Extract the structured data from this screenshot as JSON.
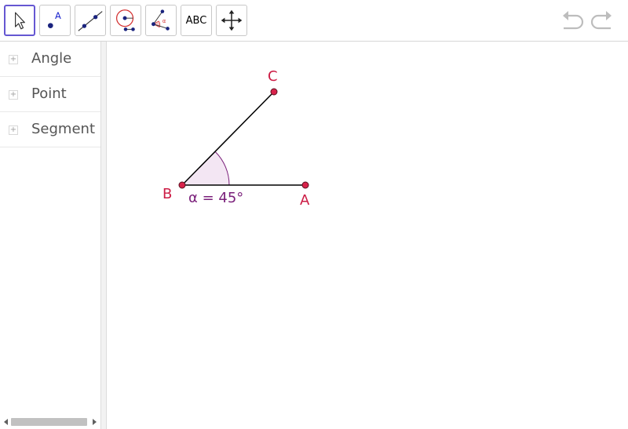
{
  "toolbar": {
    "tools": [
      {
        "name": "move",
        "icon": "cursor-arrow-icon",
        "selected": true
      },
      {
        "name": "point",
        "icon": "point-icon",
        "label": "A"
      },
      {
        "name": "line",
        "icon": "line-through-two-points-icon"
      },
      {
        "name": "circle",
        "icon": "circle-center-point-icon"
      },
      {
        "name": "angle",
        "icon": "angle-icon",
        "label": "α"
      },
      {
        "name": "text",
        "icon": "text-icon",
        "label": "ABC"
      },
      {
        "name": "move-graphics-view",
        "icon": "move-graphics-view-icon"
      }
    ],
    "undo_icon": "undo-icon",
    "redo_icon": "redo-icon"
  },
  "algebra": {
    "items": [
      {
        "label": "Angle"
      },
      {
        "label": "Point"
      },
      {
        "label": "Segment"
      }
    ],
    "expand_glyph": "+"
  },
  "graphics": {
    "points": [
      {
        "label": "A"
      },
      {
        "label": "B"
      },
      {
        "label": "C"
      }
    ],
    "angle_label": "α = 45°",
    "colors": {
      "point_fill": "#d8224a",
      "point_label": "#cc1b44",
      "angle_fill": "#f3e6f3",
      "angle_stroke": "#7a1f7a",
      "angle_label": "#7a1f7a",
      "segment": "#000000"
    }
  }
}
